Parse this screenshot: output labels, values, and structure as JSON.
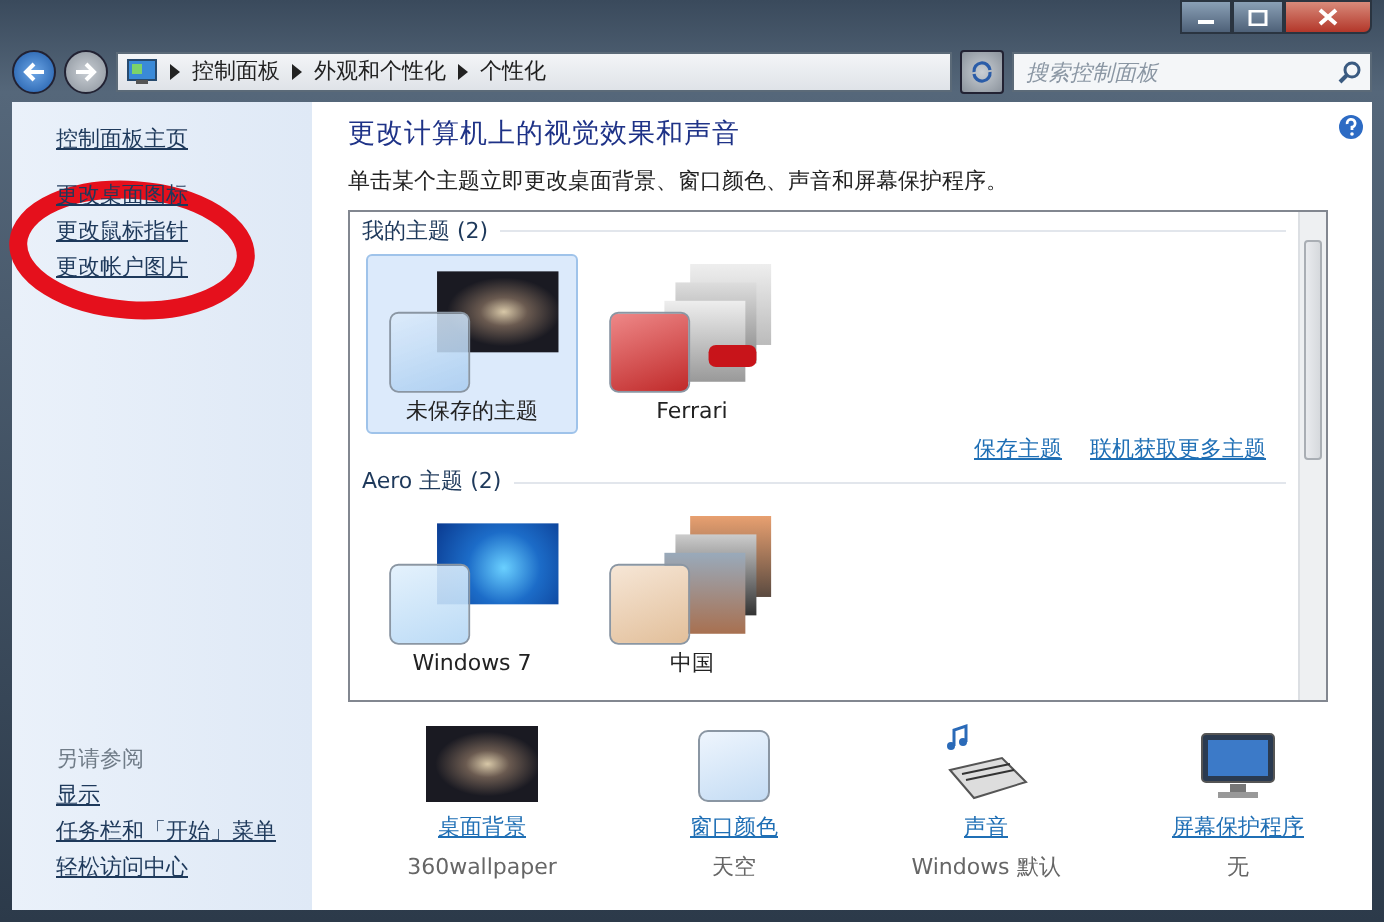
{
  "address_bar": {
    "crumbs": [
      "控制面板",
      "外观和个性化",
      "个性化"
    ],
    "search": {
      "placeholder": "搜索控制面板"
    }
  },
  "sidebar": {
    "items": [
      {
        "label": "控制面板主页"
      },
      {
        "label": "更改桌面图标"
      },
      {
        "label": "更改鼠标指针"
      },
      {
        "label": "更改帐户图片"
      }
    ],
    "see_also": {
      "title": "另请参阅",
      "items": [
        {
          "label": "显示"
        },
        {
          "label": "任务栏和「开始」菜单"
        },
        {
          "label": "轻松访问中心"
        }
      ]
    }
  },
  "main": {
    "title": "更改计算机上的视觉效果和声音",
    "description": "单击某个主题立即更改桌面背景、窗口颜色、声音和屏幕保护程序。",
    "theme_groups": [
      {
        "title": "我的主题 (2)",
        "themes": [
          {
            "name": "未保存的主题",
            "kind": "single",
            "selected": true
          },
          {
            "name": "Ferrari",
            "kind": "red",
            "selected": false
          }
        ],
        "links": [
          "保存主题",
          "联机获取更多主题"
        ]
      },
      {
        "title": "Aero 主题 (2)",
        "themes": [
          {
            "name": "Windows 7",
            "kind": "blue",
            "selected": false
          },
          {
            "name": "中国",
            "kind": "warm",
            "selected": false
          }
        ]
      }
    ],
    "settings": [
      {
        "kind": "wallpaper",
        "label": "桌面背景",
        "value": "360wallpaper"
      },
      {
        "kind": "color",
        "label": "窗口颜色",
        "value": "天空"
      },
      {
        "kind": "sound",
        "label": "声音",
        "value": "Windows 默认"
      },
      {
        "kind": "screensaver",
        "label": "屏幕保护程序",
        "value": "无"
      }
    ]
  }
}
